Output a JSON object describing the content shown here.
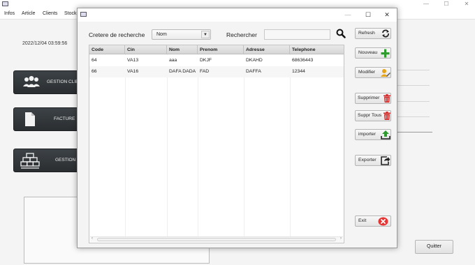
{
  "main_window": {
    "menu": [
      "Infos",
      "Article",
      "Clients",
      "Stock"
    ],
    "datetime": "2022/12/04 03:59:56",
    "side_buttons": {
      "clients": "GESTION CLIE",
      "facture": "FACTURE",
      "stock": "GESTION S"
    },
    "quit_label": "Quitter",
    "window_controls": {
      "minimize": "—",
      "maximize": "☐",
      "close": "✕"
    }
  },
  "dialog": {
    "window_controls": {
      "minimize": "—",
      "maximize": "☐",
      "close": "✕"
    },
    "search_criteria_label": "Cretere de recherche",
    "search_criteria_value": "Nom",
    "search_label": "Rechercher",
    "search_value": "",
    "table": {
      "columns": [
        "Code",
        "Cin",
        "Nom",
        "Prenom",
        "Adresse",
        "Telephone"
      ],
      "rows": [
        [
          "64",
          "VA13",
          "aaa",
          "DKJF",
          "DKAHD",
          "68636443"
        ],
        [
          "66",
          "VA16",
          "DAFA DADA",
          "FAD",
          "DAFFA",
          "12344"
        ]
      ]
    },
    "buttons": {
      "refresh": "Refresh",
      "nouveau": "Nouveau",
      "modifier": "Modifier",
      "supprimer": "Supprimer",
      "suppr_tous": "Suppr Tous",
      "importer": "importer",
      "exporter": "Exporter",
      "exit": "Exit"
    }
  },
  "colors": {
    "add_green": "#2e9b2e",
    "delete_red": "#d42a2a",
    "exit_red": "#e53535",
    "dark_button": "#2f3336"
  }
}
